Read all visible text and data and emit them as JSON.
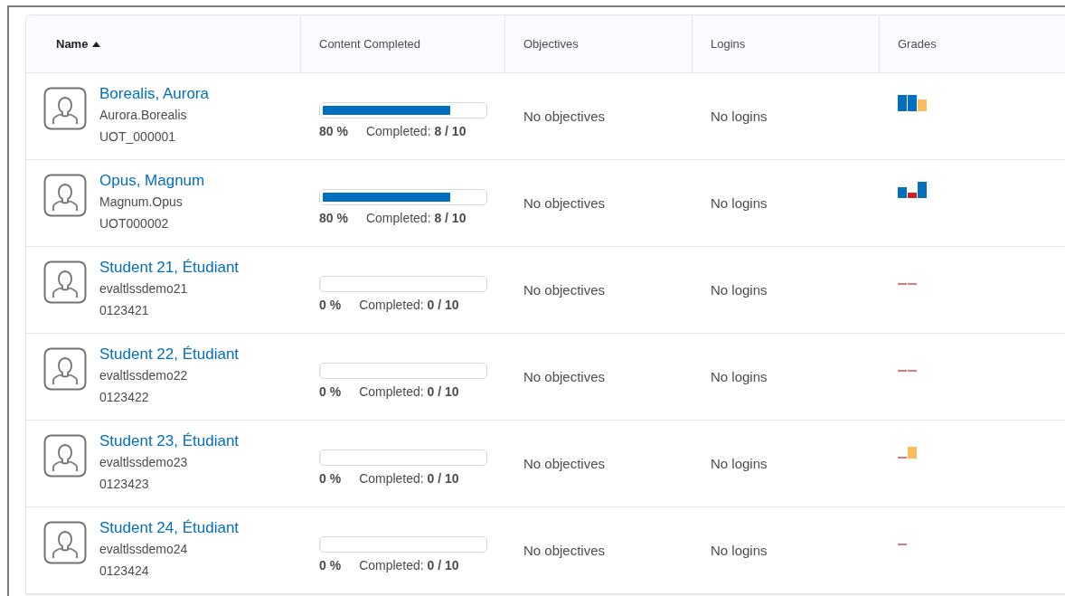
{
  "table": {
    "columns": [
      {
        "label": "Name",
        "sorted": true
      },
      {
        "label": "Content Completed",
        "sorted": false
      },
      {
        "label": "Objectives",
        "sorted": false
      },
      {
        "label": "Logins",
        "sorted": false
      },
      {
        "label": "Grades",
        "sorted": false
      }
    ],
    "rows": [
      {
        "name": "Borealis, Aurora",
        "username": "Aurora.Borealis",
        "org_id": "UOT_000001",
        "level": 0.8,
        "percent": "80 %",
        "completed": "Completed: **8 / 10**",
        "objectives": "No objectives",
        "logins": "No logins",
        "grades": [
          {
            "kind": "full"
          },
          {
            "kind": "full"
          },
          {
            "kind": "warn"
          }
        ]
      },
      {
        "name": "Opus, Magnum",
        "username": "Magnum.Opus",
        "org_id": "UOT000002",
        "level": 0.8,
        "percent": "80 %",
        "completed": "Completed: **8 / 10**",
        "objectives": "No objectives",
        "logins": "No logins",
        "grades": [
          {
            "kind": "mid"
          },
          {
            "kind": "fail"
          },
          {
            "kind": "full"
          }
        ]
      },
      {
        "name": "Student 21, Étudiant",
        "username": "evaltlssdemo21",
        "org_id": "0123421",
        "level": 0,
        "percent": "0 %",
        "completed": "Completed: **0 / 10**",
        "objectives": "No objectives",
        "logins": "No logins",
        "grades": [
          {
            "kind": "missing"
          },
          {
            "kind": "missing"
          }
        ]
      },
      {
        "name": "Student 22, Étudiant",
        "username": "evaltlssdemo22",
        "org_id": "0123422",
        "level": 0,
        "percent": "0 %",
        "completed": "Completed: **0 / 10**",
        "objectives": "No objectives",
        "logins": "No logins",
        "grades": [
          {
            "kind": "missing"
          },
          {
            "kind": "missing"
          }
        ]
      },
      {
        "name": "Student 23, Étudiant",
        "username": "evaltlssdemo23",
        "org_id": "0123423",
        "level": 0,
        "percent": "0 %",
        "completed": "Completed: **0 / 10**",
        "objectives": "No objectives",
        "logins": "No logins",
        "grades": [
          {
            "kind": "missing"
          },
          {
            "kind": "warn"
          }
        ]
      },
      {
        "name": "Student 24, Étudiant",
        "username": "evaltlssdemo24",
        "org_id": "0123424",
        "level": 0,
        "percent": "0 %",
        "completed": "Completed: **0 / 10**",
        "objectives": "No objectives",
        "logins": "No logins",
        "grades": [
          {
            "kind": "missing"
          }
        ]
      }
    ]
  }
}
